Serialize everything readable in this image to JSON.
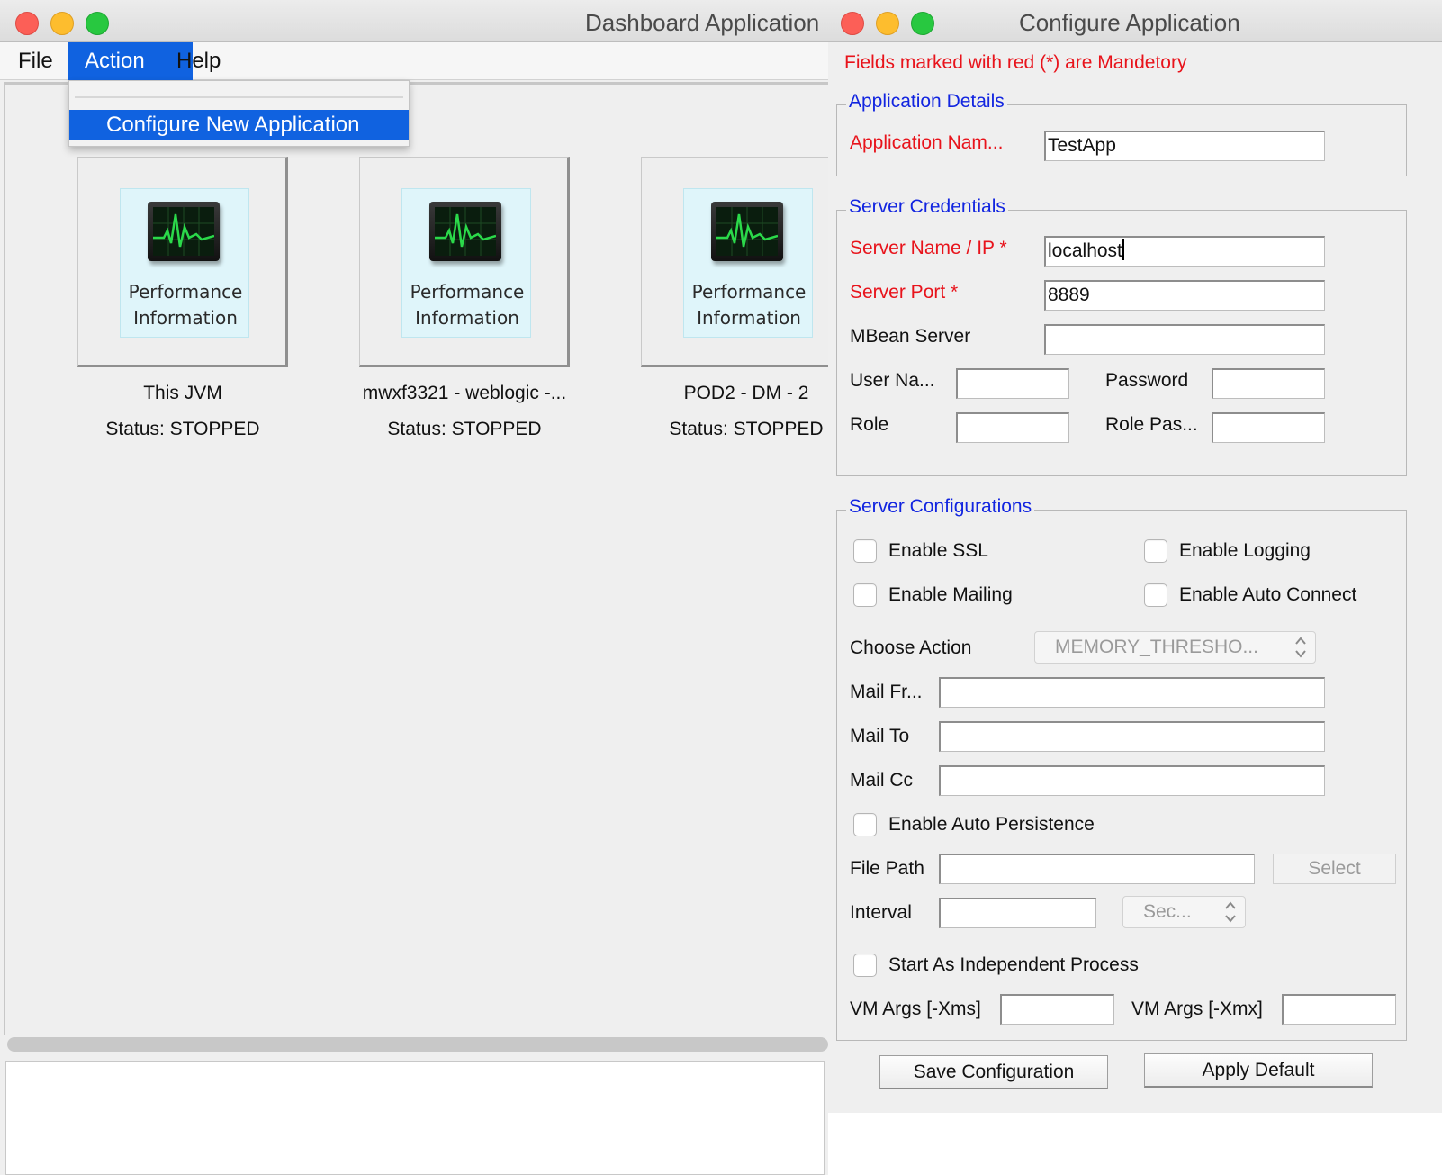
{
  "dashboard": {
    "title": "Dashboard Application",
    "menu": [
      {
        "label": "File"
      },
      {
        "label": "Action"
      },
      {
        "label": "Help"
      }
    ],
    "dropdown": {
      "item": "Configure New Application"
    },
    "tiles": [
      {
        "line1": "Performance",
        "line2": "Information",
        "name": "This JVM",
        "status": "Status: STOPPED"
      },
      {
        "line1": "Performance",
        "line2": "Information",
        "name": "mwxf3321 - weblogic -...",
        "status": "Status: STOPPED"
      },
      {
        "line1": "Performance",
        "line2": "Information",
        "name": "POD2 - DM - 2",
        "status": "Status: STOPPED"
      }
    ]
  },
  "configure": {
    "title": "Configure Application",
    "required_note": "Fields marked with red (*) are Mandetory",
    "app_details": {
      "legend": "Application Details",
      "app_name_label": "Application Nam...",
      "app_name_value": "TestApp"
    },
    "credentials": {
      "legend": "Server Credentials",
      "server_label": "Server Name / IP *",
      "server_value": "localhost",
      "port_label": "Server Port *",
      "port_value": "8889",
      "mbean_label": "MBean Server",
      "mbean_value": "",
      "user_label": "User Na...",
      "password_label": "Password",
      "role_label": "Role",
      "role_password_label": "Role Pas..."
    },
    "config": {
      "legend": "Server Configurations",
      "ssl": "Enable SSL",
      "logging": "Enable Logging",
      "mailing": "Enable Mailing",
      "auto_connect": "Enable Auto Connect",
      "choose_action_label": "Choose Action",
      "choose_action_value": "MEMORY_THRESHO...",
      "mail_from_label": "Mail Fr...",
      "mail_to_label": "Mail To",
      "mail_cc_label": "Mail Cc",
      "auto_persistence": "Enable Auto Persistence",
      "file_path_label": "File Path",
      "select_button": "Select",
      "interval_label": "Interval",
      "interval_unit": "Sec...",
      "independent": "Start As Independent Process",
      "xms_label": "VM Args [-Xms]",
      "xmx_label": "VM Args [-Xmx]"
    },
    "buttons": {
      "save": "Save Configuration",
      "apply": "Apply Default"
    }
  }
}
